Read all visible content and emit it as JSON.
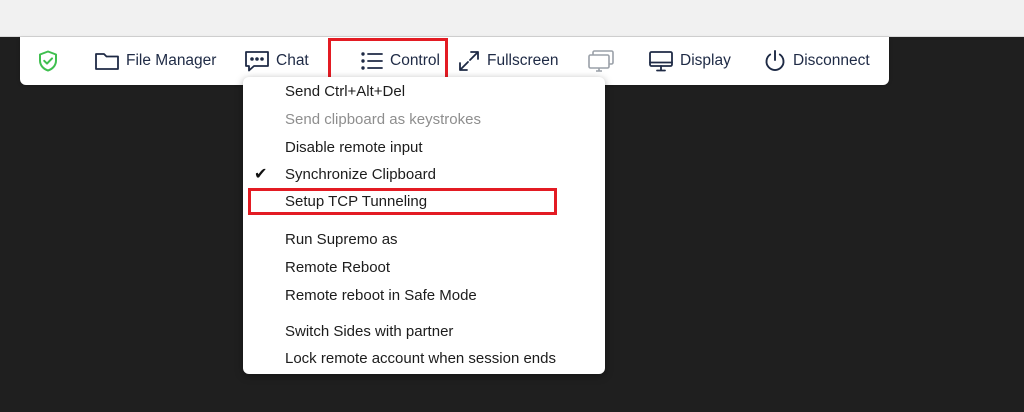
{
  "toolbar": {
    "items": [
      {
        "id": "shield",
        "icon": "shield-check-icon",
        "label": ""
      },
      {
        "id": "file_manager",
        "icon": "folder-icon",
        "label": "File Manager"
      },
      {
        "id": "chat",
        "icon": "chat-bubble-icon",
        "label": "Chat"
      },
      {
        "id": "control",
        "icon": "list-icon",
        "label": "Control"
      },
      {
        "id": "fullscreen",
        "icon": "expand-icon",
        "label": "Fullscreen"
      },
      {
        "id": "monitors",
        "icon": "multi-monitor-icon",
        "label": ""
      },
      {
        "id": "display",
        "icon": "monitor-icon",
        "label": "Display"
      },
      {
        "id": "disconnect",
        "icon": "power-icon",
        "label": "Disconnect"
      }
    ]
  },
  "control_menu": {
    "items": [
      {
        "label": "Send Ctrl+Alt+Del",
        "enabled": true,
        "checked": false
      },
      {
        "label": "Send clipboard as keystrokes",
        "enabled": false,
        "checked": false
      },
      {
        "label": "Disable remote input",
        "enabled": true,
        "checked": false
      },
      {
        "label": "Synchronize Clipboard",
        "enabled": true,
        "checked": true
      },
      {
        "label": "Setup TCP Tunneling",
        "enabled": true,
        "checked": false,
        "highlighted": true
      },
      {
        "label": "Run Supremo as",
        "enabled": true,
        "checked": false
      },
      {
        "label": "Remote Reboot",
        "enabled": true,
        "checked": false
      },
      {
        "label": "Remote reboot in Safe Mode",
        "enabled": true,
        "checked": false
      },
      {
        "label": "Switch Sides with partner",
        "enabled": true,
        "checked": false
      },
      {
        "label": "Lock remote account when session ends",
        "enabled": true,
        "checked": false
      }
    ],
    "check_glyph": "✔"
  },
  "colors": {
    "highlight_border": "#e31b23",
    "toolbar_text": "#1e2a45",
    "shield_green": "#3fbf4f",
    "remote_background": "#1f1f1f"
  }
}
